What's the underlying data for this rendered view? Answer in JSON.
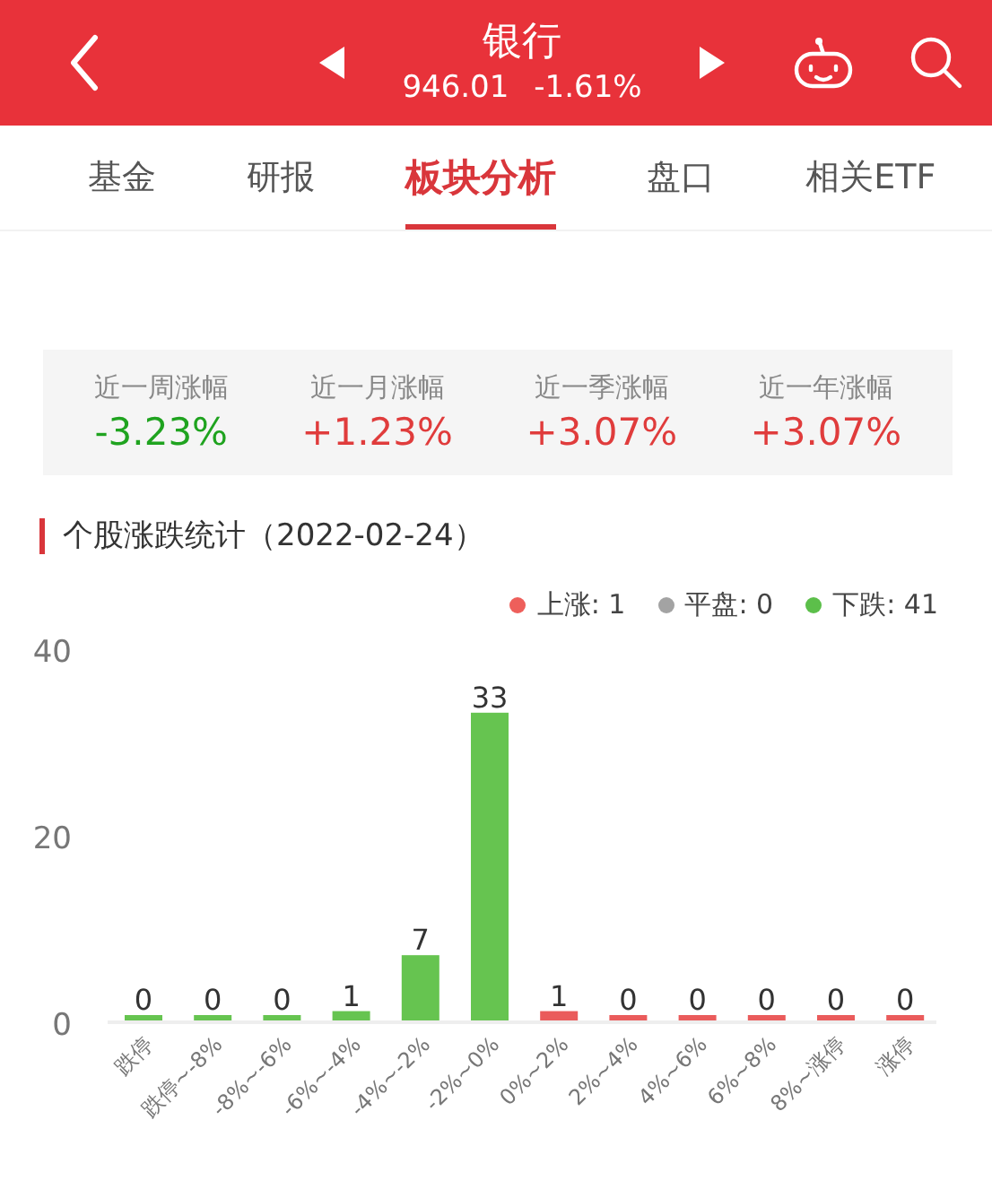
{
  "header": {
    "title": "银行",
    "price": "946.01",
    "change": "-1.61%"
  },
  "tabs": [
    {
      "label": "基金",
      "selected": false
    },
    {
      "label": "研报",
      "selected": false
    },
    {
      "label": "板块分析",
      "selected": true
    },
    {
      "label": "盘口",
      "selected": false
    },
    {
      "label": "相关ETF",
      "selected": false
    }
  ],
  "returns": [
    {
      "label": "近一周涨幅",
      "value": "-3.23%",
      "color": "#1fa31f"
    },
    {
      "label": "近一月涨幅",
      "value": "+1.23%",
      "color": "#e03c3c"
    },
    {
      "label": "近一季涨幅",
      "value": "+3.07%",
      "color": "#e03c3c"
    },
    {
      "label": "近一年涨幅",
      "value": "+3.07%",
      "color": "#e03c3c"
    }
  ],
  "section_title": "个股涨跌统计（2022-02-24）",
  "legend": [
    {
      "label": "上涨: 1",
      "color": "#ee5f5b"
    },
    {
      "label": "平盘: 0",
      "color": "#a3a3a3"
    },
    {
      "label": "下跌: 41",
      "color": "#5cbf4a"
    }
  ],
  "chart_data": {
    "type": "bar",
    "data_labels": true,
    "yticks": [
      0,
      20,
      40
    ],
    "ylim": [
      0,
      40
    ],
    "categories": [
      "跌停",
      "跌停~-8%",
      "-8%~-6%",
      "-6%~-4%",
      "-4%~-2%",
      "-2%~0%",
      "0%~2%",
      "2%~4%",
      "4%~6%",
      "6%~8%",
      "8%~涨停",
      "涨停"
    ],
    "series": [
      {
        "color": "#66c450",
        "values": [
          0,
          0,
          0,
          1,
          7,
          33,
          null,
          null,
          null,
          null,
          null,
          null
        ]
      },
      {
        "color": "#ea5b5b",
        "values": [
          null,
          null,
          null,
          null,
          null,
          null,
          1,
          0,
          0,
          0,
          0,
          0
        ]
      }
    ]
  }
}
